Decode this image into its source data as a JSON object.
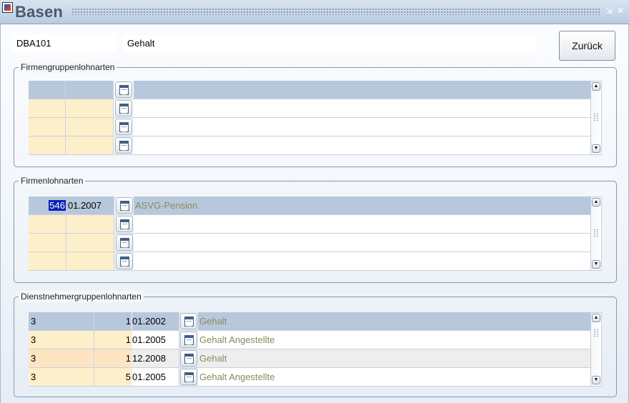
{
  "window": {
    "title": "Basen",
    "minimize_glyph": "⇲",
    "close_glyph": "✕"
  },
  "header": {
    "code": "DBA101",
    "name": "Gehalt",
    "back_label": "Zurück"
  },
  "firmengruppen": {
    "legend": "Firmengruppenlohnarten"
  },
  "firmen": {
    "legend": "Firmenlohnarten",
    "row0": {
      "number": "546",
      "date": "01.2007",
      "name": "ASVG-Pension"
    }
  },
  "dienstnehmer": {
    "legend": "Dienstnehmergruppenlohnarten",
    "rows": [
      {
        "group": "3",
        "count": "1",
        "date": "01.2002",
        "name": "Gehalt"
      },
      {
        "group": "3",
        "count": "1",
        "date": "01.2005",
        "name": "Gehalt Angestellte"
      },
      {
        "group": "3",
        "count": "1",
        "date": "12.2008",
        "name": "Gehalt"
      },
      {
        "group": "3",
        "count": "5",
        "date": "01.2005",
        "name": "Gehalt Angestellte"
      }
    ]
  },
  "scroll": {
    "up_glyph": "▲",
    "down_glyph": "▼"
  },
  "colors": {
    "selected_row": "#b8c8dc",
    "input_cell": "#fdefc9",
    "highlight": "#0a1fb8",
    "description_text": "#8a8a5e"
  }
}
